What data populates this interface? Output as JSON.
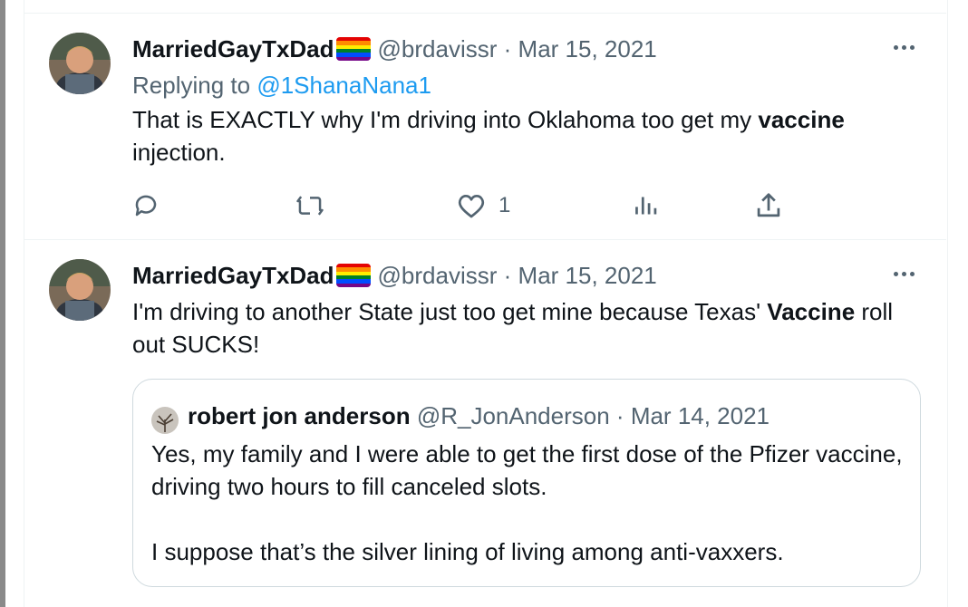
{
  "tweets": [
    {
      "display_name": "MarriedGayTxDad",
      "handle": "@brdavissr",
      "sep": "·",
      "date": "Mar 15, 2021",
      "replying_prefix": "Replying to ",
      "replying_handle": "@1ShanaNana1",
      "text_before": "That is EXACTLY why I'm driving into Oklahoma too get my ",
      "text_bold": "vaccine",
      "text_after": " injection.",
      "actions": {
        "like_count": "1"
      }
    },
    {
      "display_name": "MarriedGayTxDad",
      "handle": "@brdavissr",
      "sep": "·",
      "date": "Mar 15, 2021",
      "text_before": "I'm driving to another State just too get mine because Texas' ",
      "text_bold": "Vaccine",
      "text_after": " roll out SUCKS!",
      "quote": {
        "display_name": "robert jon anderson",
        "handle": "@R_JonAnderson",
        "sep": "·",
        "date": "Mar 14, 2021",
        "paragraph1": "Yes, my family and I were able to get the first dose of the Pfizer vaccine, driving two hours to fill canceled slots.",
        "paragraph2": "I suppose that’s the silver lining of living among anti-vaxxers."
      }
    }
  ],
  "icons": {
    "more": "more-horizontal-icon",
    "reply": "reply-icon",
    "retweet": "retweet-icon",
    "like": "heart-icon",
    "views": "views-icon",
    "share": "share-icon",
    "flag": "rainbow-flag-icon"
  },
  "colors": {
    "text": "#0f1419",
    "secondary": "#536471",
    "link": "#1d9bf0",
    "border": "#cfd9de",
    "divider": "#eff3f4"
  }
}
